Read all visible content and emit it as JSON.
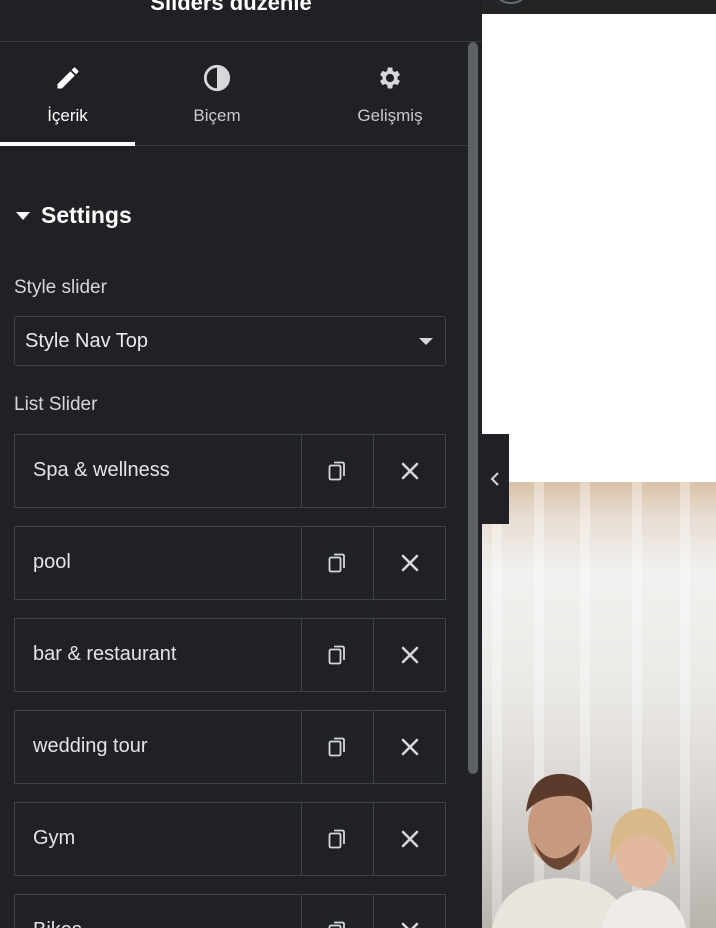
{
  "panel": {
    "title": "Sliders düzenle"
  },
  "tabs": [
    {
      "label": "İçerik",
      "icon": "pencil-icon",
      "active": true
    },
    {
      "label": "Biçem",
      "icon": "half-circle-icon",
      "active": false
    },
    {
      "label": "Gelişmiş",
      "icon": "gear-icon",
      "active": false
    }
  ],
  "settings": {
    "section_title": "Settings",
    "style_label": "Style slider",
    "style_value": "Style Nav Top",
    "list_label": "List Slider",
    "items": [
      {
        "title": "Spa & wellness"
      },
      {
        "title": "pool"
      },
      {
        "title": "bar & restaurant"
      },
      {
        "title": "wedding tour"
      },
      {
        "title": "Gym"
      },
      {
        "title": "Bikes"
      }
    ]
  },
  "colors": {
    "panel_bg": "#1f2124",
    "border": "#3f4247",
    "active_tab_underline": "#ffffff"
  }
}
